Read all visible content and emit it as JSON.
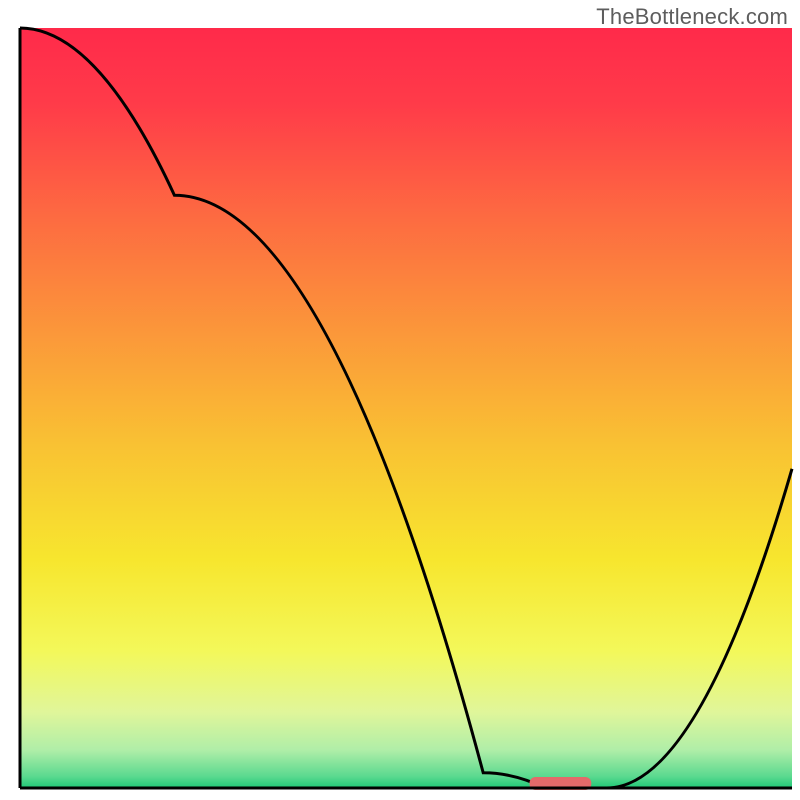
{
  "watermark": "TheBottleneck.com",
  "chart_data": {
    "type": "line",
    "title": "",
    "xlabel": "",
    "ylabel": "",
    "xlim": [
      0,
      100
    ],
    "ylim": [
      0,
      100
    ],
    "x": [
      0,
      20,
      60,
      68,
      76,
      100
    ],
    "values": [
      100,
      78,
      2,
      0,
      0,
      42
    ],
    "marker": {
      "x_start": 66,
      "x_end": 74,
      "y": 0.5
    },
    "background_gradient": {
      "stops": [
        {
          "offset": 0.0,
          "color": "#ff2a4a"
        },
        {
          "offset": 0.1,
          "color": "#ff3b49"
        },
        {
          "offset": 0.25,
          "color": "#fd6b41"
        },
        {
          "offset": 0.4,
          "color": "#fb973a"
        },
        {
          "offset": 0.55,
          "color": "#f9c233"
        },
        {
          "offset": 0.7,
          "color": "#f7e62e"
        },
        {
          "offset": 0.82,
          "color": "#f3f85a"
        },
        {
          "offset": 0.9,
          "color": "#e0f69a"
        },
        {
          "offset": 0.95,
          "color": "#b0eea8"
        },
        {
          "offset": 0.985,
          "color": "#5ad98f"
        },
        {
          "offset": 1.0,
          "color": "#1fc877"
        }
      ]
    },
    "axis_color": "#000000",
    "curve_color": "#000000",
    "marker_color": "#e46a6a"
  }
}
